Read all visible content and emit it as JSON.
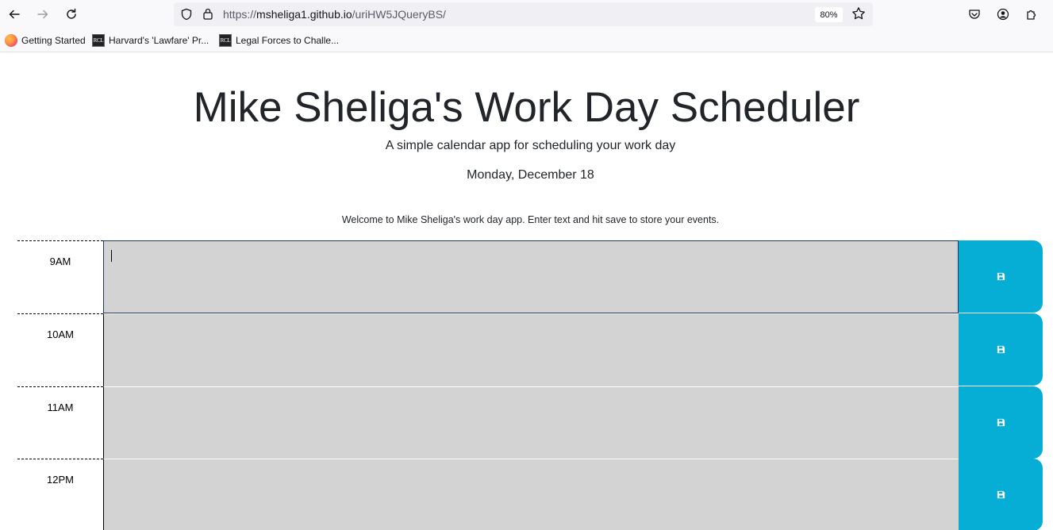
{
  "browser": {
    "url_host": "msheliga1.github.io",
    "url_protocol": "https://",
    "url_path": "/uriHW5JQueryBS/",
    "zoom": "80%",
    "bookmarks": [
      {
        "label": "Getting Started",
        "icon": "firefox-icon"
      },
      {
        "label": "Harvard's 'Lawfare' Pr...",
        "icon": "rcl-icon"
      },
      {
        "label": "Legal Forces to Challe...",
        "icon": "rcl-icon"
      }
    ],
    "bookmark_favicon_text": "RCL"
  },
  "header": {
    "title": "Mike Sheliga's Work Day Scheduler",
    "lead": "A simple calendar app for scheduling your work day",
    "current_day": "Monday, December 18"
  },
  "welcome": "Welcome to Mike Sheliga's work day app. Enter text and hit save to store your events.",
  "schedule": [
    {
      "hour": "9AM",
      "text": "",
      "focused": true
    },
    {
      "hour": "10AM",
      "text": ""
    },
    {
      "hour": "11AM",
      "text": ""
    },
    {
      "hour": "12PM",
      "text": ""
    }
  ],
  "colors": {
    "save_button": "#06aed5",
    "timeblock_past": "#d3d3d3"
  }
}
